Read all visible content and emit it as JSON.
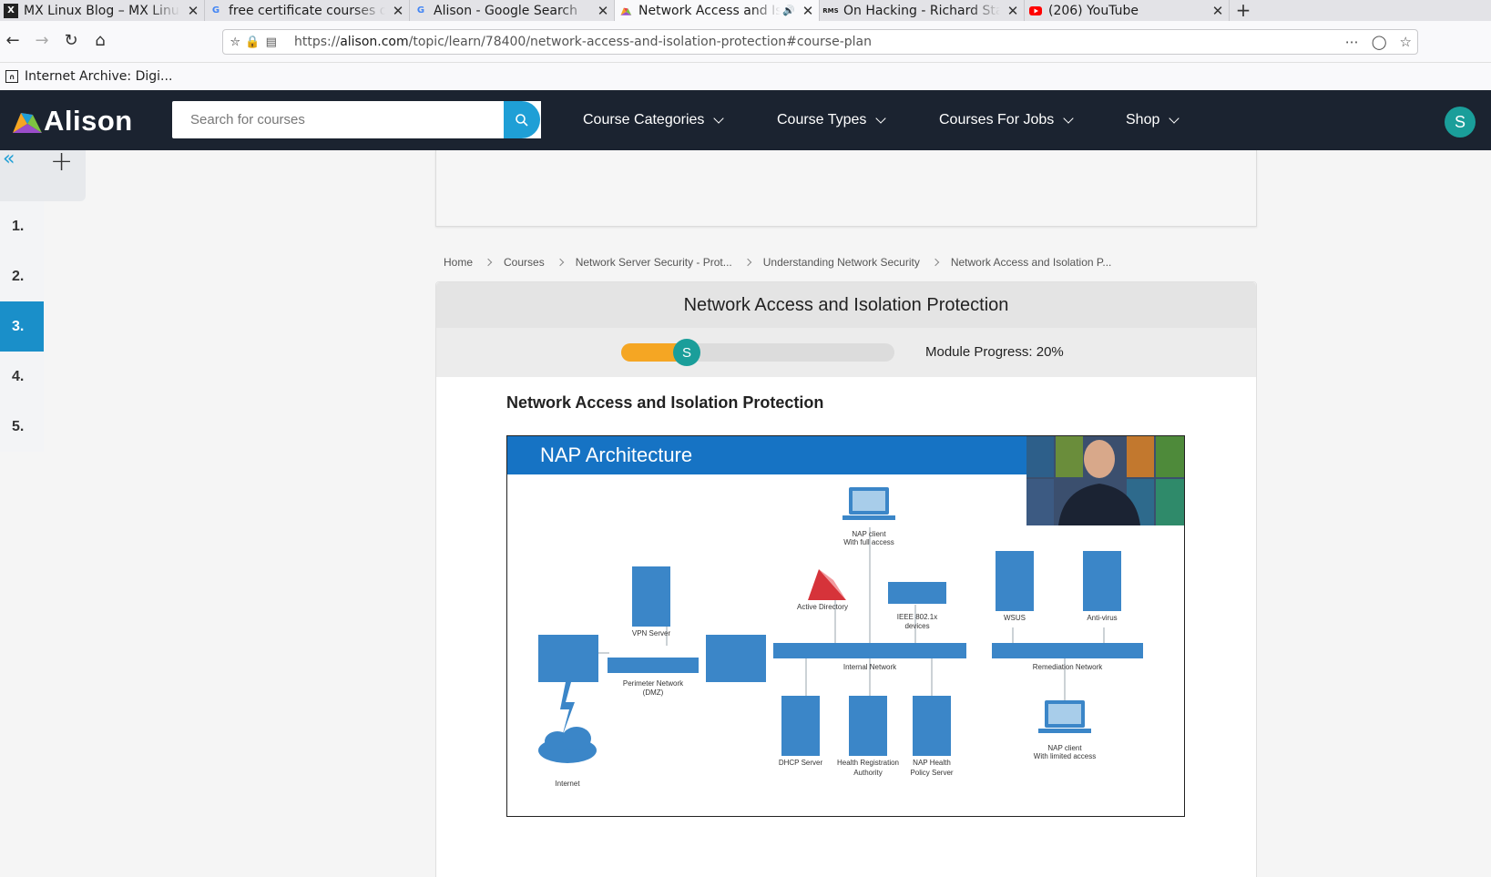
{
  "browser": {
    "tabs": [
      {
        "title": "MX Linux Blog – MX Linux",
        "favicon": "X",
        "active": false
      },
      {
        "title": "free certificate courses online",
        "favicon": "G",
        "active": false
      },
      {
        "title": "Alison - Google Search",
        "favicon": "G",
        "active": false
      },
      {
        "title": "Network Access and Isolation",
        "favicon": "alison",
        "active": true
      },
      {
        "title": "On Hacking - Richard Stallman",
        "favicon": "RMS",
        "active": false
      },
      {
        "title": "(206) YouTube",
        "favicon": "youtube",
        "active": false
      }
    ],
    "url_prefix": "https://",
    "url_host": "alison.com",
    "url_path": "/topic/learn/78400/network-access-and-isolation-protection#course-plan",
    "bookmarks": [
      {
        "label": "Internet Archive: Digi..."
      }
    ]
  },
  "header": {
    "logo_text": "Alison",
    "search_placeholder": "Search for courses",
    "menus": [
      {
        "label": "Course Categories"
      },
      {
        "label": "Course Types"
      },
      {
        "label": "Courses For Jobs"
      },
      {
        "label": "Shop"
      }
    ],
    "avatar_initial": "S",
    "colors": {
      "bg": "#1b2330",
      "accent": "#1f9fd6"
    }
  },
  "sidebar": {
    "modules": [
      {
        "label": "1.",
        "active": false
      },
      {
        "label": "2.",
        "active": false
      },
      {
        "label": "3.",
        "active": true
      },
      {
        "label": "4.",
        "active": false
      },
      {
        "label": "5.",
        "active": false
      }
    ]
  },
  "breadcrumb": [
    "Home",
    "Courses",
    "Network Server Security - Prot...",
    "Understanding Network Security",
    "Network Access and Isolation P..."
  ],
  "module": {
    "title": "Network Access and Isolation Protection",
    "progress_label": "Module Progress: 20%",
    "progress_fraction": 0.2,
    "progress_initial": "S"
  },
  "lesson": {
    "title": "Network Access and Isolation Protection",
    "slide_title": "NAP Architecture",
    "diagram_labels": {
      "nap_full": [
        "NAP client",
        "With full access"
      ],
      "active_directory": "Active Directory",
      "ieee": [
        "IEEE 802.1x",
        "devices"
      ],
      "wsus": "WSUS",
      "antivirus": "Anti-virus",
      "vpn": "VPN Server",
      "perimeter": [
        "Perimeter Network",
        "(DMZ)"
      ],
      "internal": "Internal Network",
      "remediation": "Remediation Network",
      "dhcp": "DHCP Server",
      "hra": [
        "Health Registration",
        "Authority"
      ],
      "naphps": [
        "NAP Health",
        "Policy Server"
      ],
      "nap_limited": [
        "NAP client",
        "With limited access"
      ],
      "internet": "Internet"
    }
  }
}
